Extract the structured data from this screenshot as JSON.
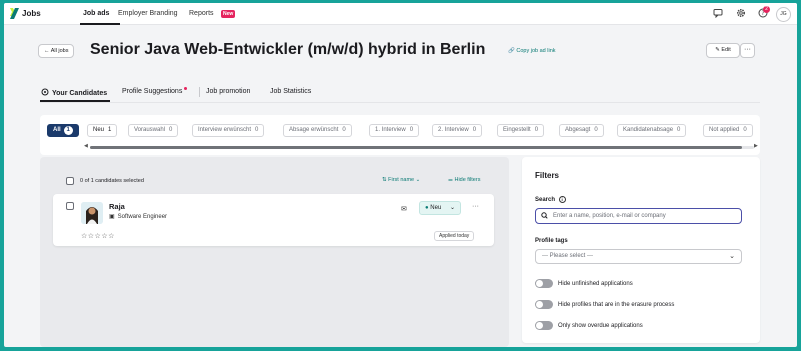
{
  "nav": {
    "logo": "Jobs",
    "links": [
      "Job ads",
      "Employer Branding",
      "Reports"
    ],
    "new_badge": "New",
    "notification_count": "2",
    "user_initials": "JG"
  },
  "header": {
    "back_label": "All jobs",
    "title": "Senior Java Web-Entwickler (m/w/d) hybrid in Berlin",
    "copy_link": "Copy job ad link",
    "edit_label": "Edit",
    "more_label": "···"
  },
  "tabs": [
    "Your Candidates",
    "Profile Suggestions",
    "Job promotion",
    "Job Statistics"
  ],
  "stages": [
    {
      "label": "All",
      "count": "1"
    },
    {
      "label": "Neu",
      "count": "1"
    },
    {
      "label": "Vorauswahl",
      "count": "0"
    },
    {
      "label": "Interview erwünscht",
      "count": "0"
    },
    {
      "label": "Absage erwünscht",
      "count": "0"
    },
    {
      "label": "1. Interview",
      "count": "0"
    },
    {
      "label": "2. Interview",
      "count": "0"
    },
    {
      "label": "Eingestellt",
      "count": "0"
    },
    {
      "label": "Abgesagt",
      "count": "0"
    },
    {
      "label": "Kandidatenabsage",
      "count": "0"
    },
    {
      "label": "Not applied",
      "count": "0"
    }
  ],
  "candidates_toolbar": {
    "selected_text": "0 of 1 candidates selected",
    "sort_label": "First name",
    "hide_filters": "Hide filters"
  },
  "candidate": {
    "name": "Raja",
    "role": "Software Engineer",
    "stars": "☆☆☆☆☆",
    "status": "Neu",
    "applied": "Applied today"
  },
  "filters": {
    "title": "Filters",
    "search_label": "Search",
    "search_placeholder": "Enter a name, position, e-mail or company",
    "profile_tags_label": "Profile tags",
    "profile_tags_value": "--- Please select ---",
    "toggles": [
      "Hide unfinished applications",
      "Hide profiles that are in the erasure process",
      "Only show overdue applications"
    ]
  },
  "colors": {
    "accent": "#0a7a74",
    "brand_green": "#c6f23b",
    "badge": "#e5245e",
    "all_pill": "#1b3a6b"
  }
}
